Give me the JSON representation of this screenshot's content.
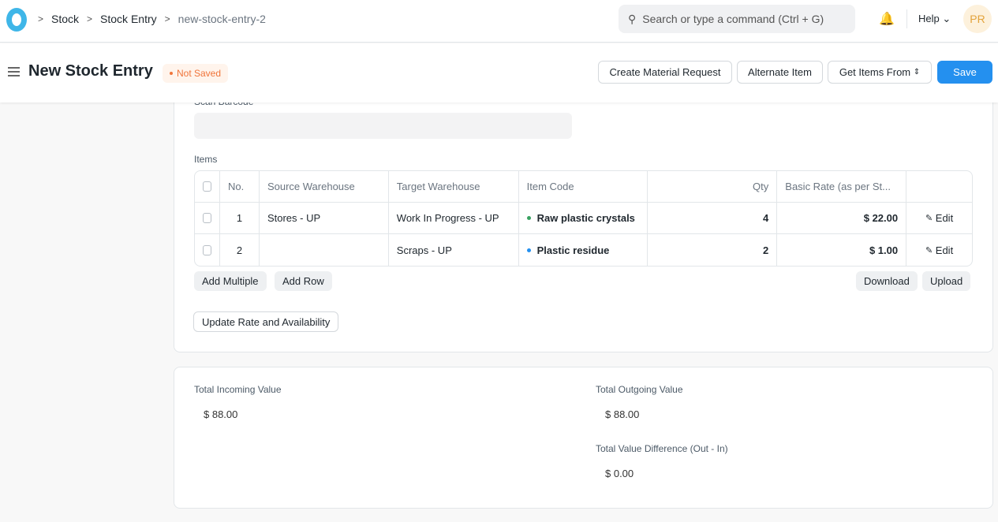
{
  "nav": {
    "breadcrumbs": [
      "Stock",
      "Stock Entry",
      "new-stock-entry-2"
    ],
    "search_placeholder": "Search or type a command (Ctrl + G)",
    "help": "Help",
    "avatar": "PR"
  },
  "header": {
    "title": "New Stock Entry",
    "status": "Not Saved",
    "buttons": {
      "create_mr": "Create Material Request",
      "alternate": "Alternate Item",
      "get_items": "Get Items From",
      "save": "Save"
    }
  },
  "form": {
    "scan_barcode_label": "Scan Barcode",
    "items_label": "Items",
    "columns": [
      "No.",
      "Source Warehouse",
      "Target Warehouse",
      "Item Code",
      "Qty",
      "Basic Rate (as per St..."
    ],
    "rows": [
      {
        "no": "1",
        "source": "Stores - UP",
        "target": "Work In Progress - UP",
        "item": "Raw plastic crystals",
        "item_dot": "#38a160",
        "qty": "4",
        "rate": "$ 22.00",
        "edit": "Edit"
      },
      {
        "no": "2",
        "source": "",
        "target": "Scraps - UP",
        "item": "Plastic residue",
        "item_dot": "#2490ef",
        "qty": "2",
        "rate": "$ 1.00",
        "edit": "Edit"
      }
    ],
    "add_multiple": "Add Multiple",
    "add_row": "Add Row",
    "download": "Download",
    "upload": "Upload",
    "update_rate": "Update Rate and Availability"
  },
  "totals": {
    "incoming_label": "Total Incoming Value",
    "incoming": "$ 88.00",
    "outgoing_label": "Total Outgoing Value",
    "outgoing": "$ 88.00",
    "diff_label": "Total Value Difference (Out - In)",
    "diff": "$ 0.00"
  }
}
